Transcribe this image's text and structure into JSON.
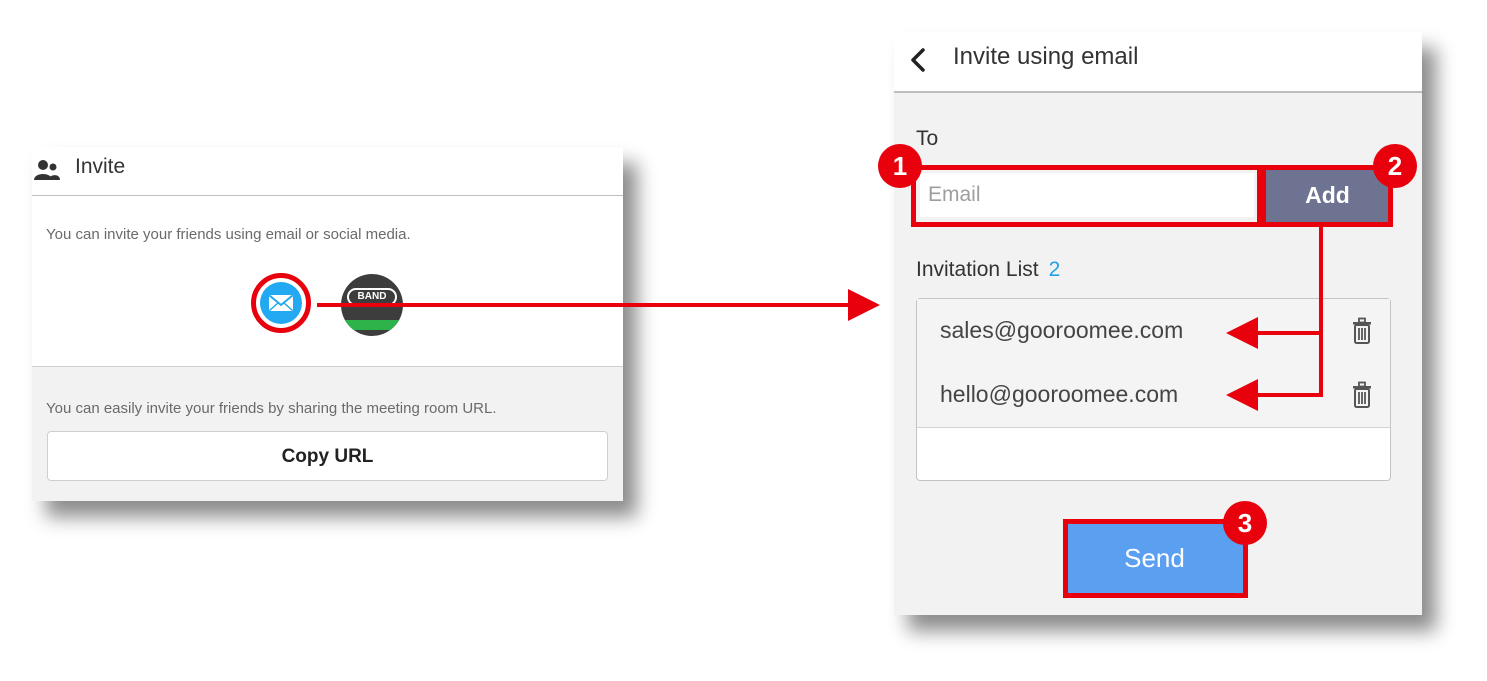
{
  "invite_panel": {
    "title": "Invite",
    "header_icon": "people-icon",
    "social_text": "You can invite your friends using email or social media.",
    "email_icon": "envelope-icon",
    "band_label": "BAND",
    "url_text": "You can easily invite your friends by sharing the meeting room URL.",
    "copy_url_label": "Copy URL"
  },
  "email_panel": {
    "back_icon": "chevron-left-icon",
    "title": "Invite using email",
    "to_label": "To",
    "email_placeholder": "Email",
    "add_label": "Add",
    "invitation_list_label": "Invitation List",
    "invitation_count": "2",
    "invitations": [
      {
        "email": "sales@gooroomee.com"
      },
      {
        "email": "hello@gooroomee.com"
      }
    ],
    "trash_icon": "trash-icon",
    "send_label": "Send"
  },
  "annotations": {
    "badges": [
      "1",
      "2",
      "3"
    ],
    "highlight_color": "#e8000d"
  },
  "colors": {
    "add_button": "#6e7391",
    "send_button": "#5a9ff0",
    "count_accent": "#1fa2e6",
    "email_icon_bg": "#23a8f2",
    "band_green": "#2db34a"
  }
}
